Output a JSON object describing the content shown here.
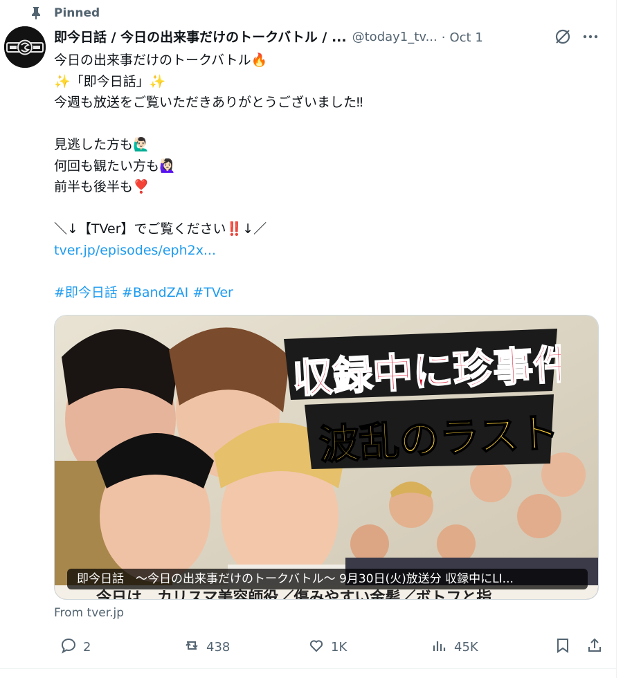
{
  "pinned": {
    "label": "Pinned"
  },
  "tweet": {
    "display_name": "即今日話 / 今日の出来事だけのトークバトル / ...",
    "handle": "@today1_tv...",
    "separator": "·",
    "date": "Oct 1",
    "lines": [
      "今日の出来事だけのトークバトル🔥",
      "✨「即今日話」✨",
      "今週も放送をご覧いただきありがとうございました‼",
      "",
      "見逃した方も🙋🏻‍♂️",
      "何回も観たい方も🙋🏻‍♀️",
      "前半も後半も❣️",
      "",
      "＼↓【TVer】でご覧ください‼️↓／"
    ],
    "link_text": "tver.jp/episodes/eph2x...",
    "hashtags": "#即今日話 #BandZAI #TVer"
  },
  "card": {
    "headline_line1": "収録中に珍事件が!!",
    "headline_line2": "波乱のラスト…",
    "caption": "即今日話　～今日の出来事だけのトークバトル～ 9月30日(火)放送分 収録中にLI...",
    "bottom_strip": "今日は…カリスマ美容師役／傷みやすい金髪／ボトフと指",
    "source": "From tver.jp"
  },
  "actions": {
    "replies": "2",
    "reposts": "438",
    "likes": "1K",
    "views": "45K"
  },
  "icons": {
    "pin": "pin-icon",
    "grok": "grok-icon",
    "more": "more-icon",
    "reply": "reply-icon",
    "repost": "repost-icon",
    "like": "heart-icon",
    "views": "views-icon",
    "bookmark": "bookmark-icon",
    "share": "share-icon"
  },
  "colors": {
    "text": "#0f1419",
    "secondary": "#536471",
    "link": "#1d9bf0",
    "headline_red": "#d7102a",
    "headline_yellow": "#ffd23a"
  }
}
